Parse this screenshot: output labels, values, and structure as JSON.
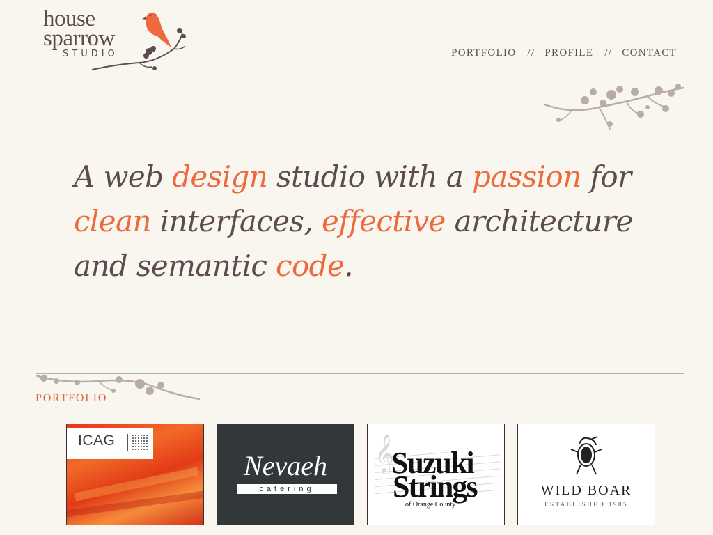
{
  "logo": {
    "line1": "house",
    "line2": "sparrow",
    "line3": "STUDIO"
  },
  "nav": {
    "items": [
      "PORTFOLIO",
      "PROFILE",
      "CONTACT"
    ],
    "separator": "//"
  },
  "hero": {
    "segments": [
      {
        "text": "A web ",
        "hl": false
      },
      {
        "text": "design",
        "hl": true
      },
      {
        "text": " studio with a ",
        "hl": false
      },
      {
        "text": "passion",
        "hl": true
      },
      {
        "text": " for ",
        "hl": false
      },
      {
        "text": "clean",
        "hl": true
      },
      {
        "text": " interfaces, ",
        "hl": false
      },
      {
        "text": "effective",
        "hl": true
      },
      {
        "text": " architecture and semantic ",
        "hl": false
      },
      {
        "text": "code",
        "hl": true
      },
      {
        "text": ".",
        "hl": false
      }
    ]
  },
  "portfolio": {
    "title": "PORTFOLIO",
    "items": [
      {
        "label": "ICAG"
      },
      {
        "name": "Nevaeh",
        "sub": "catering"
      },
      {
        "line1": "Suzuki",
        "line2": "Strings",
        "line3": "of Orange County"
      },
      {
        "name": "WILD BOAR",
        "sub": "ESTABLISHED 1985"
      }
    ]
  },
  "colors": {
    "accent": "#ee6a3c",
    "text": "#5e4b4f",
    "background": "#f8f6ef",
    "branch": "#b9aca8"
  }
}
